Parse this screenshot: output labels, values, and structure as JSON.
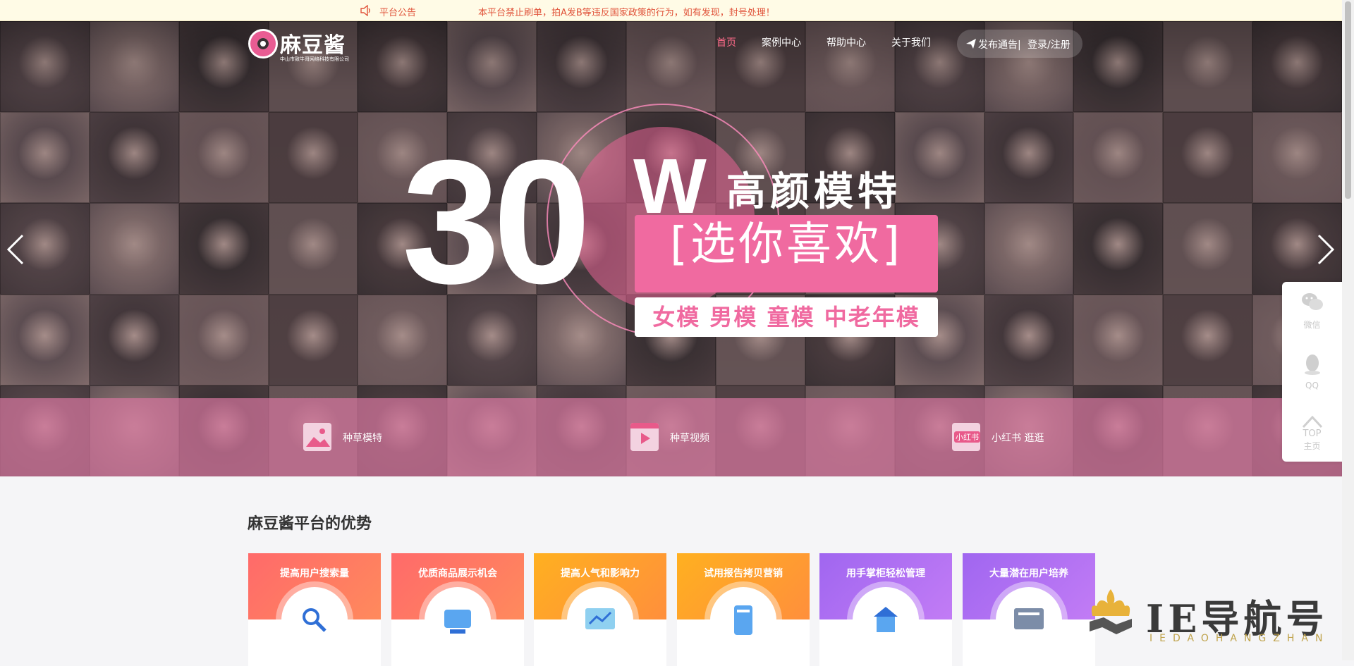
{
  "notice": {
    "label": "平台公告",
    "message": "本平台禁止刷单，拍A发B等违反国家政策的行为，如有发现，封号处理！"
  },
  "logo": {
    "name": "麻豆酱",
    "company": "中山市致牛哥网络科技有限公司"
  },
  "nav": {
    "items": [
      "首页",
      "案例中心",
      "帮助中心",
      "关于我们"
    ],
    "publish": "发布通告|",
    "login": "登录/注册"
  },
  "hero": {
    "number": "30",
    "unit": "W",
    "headline": "高颜模特",
    "pick": "[选你喜欢]",
    "types": "女模 男模 童模 中老年模"
  },
  "strip": {
    "items": [
      {
        "label": "种草模特",
        "icon": "image-icon"
      },
      {
        "label": "种草视频",
        "icon": "video-play-icon"
      },
      {
        "label": "小红书 逛逛",
        "badge": "小红书",
        "icon": "xiaohongshu-icon"
      }
    ]
  },
  "side": {
    "wechat": "微信",
    "qq": "QQ",
    "top": "TOP",
    "top_sub": "主页"
  },
  "advantages": {
    "title": "麻豆酱平台的优势",
    "cards": [
      {
        "title": "提高用户搜索量",
        "color_top": "#ff6a6a",
        "color_bottom": "#ff8a5c"
      },
      {
        "title": "优质商品展示机会",
        "color_top": "#ff6a6a",
        "color_bottom": "#ff8a5c"
      },
      {
        "title": "提高人气和影响力",
        "color_top": "#ffb020",
        "color_bottom": "#ff8f3c"
      },
      {
        "title": "试用报告拷贝营销",
        "color_top": "#ffb020",
        "color_bottom": "#ff8f3c"
      },
      {
        "title": "用手掌柜轻松管理",
        "color_top": "#a066f0",
        "color_bottom": "#c27cf5"
      },
      {
        "title": "大量潜在用户培养",
        "color_top": "#a066f0",
        "color_bottom": "#c27cf5"
      }
    ]
  },
  "watermark": {
    "text": "IE导航号",
    "sub": "IEDAOHANGZHAN"
  },
  "colors": {
    "accent": "#f06aa0",
    "nav_active": "#ff6b8a",
    "notice_text": "#e0533a"
  }
}
